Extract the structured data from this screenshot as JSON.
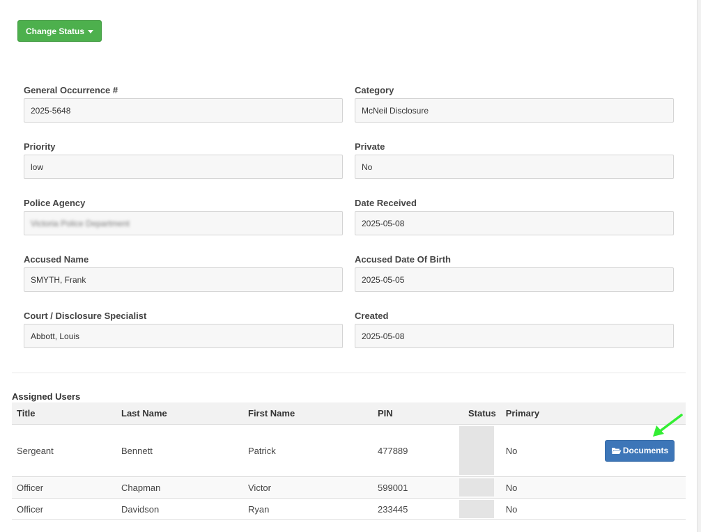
{
  "toolbar": {
    "change_status_label": "Change Status"
  },
  "form": {
    "general_occurrence": {
      "label": "General Occurrence #",
      "value": "2025-5648"
    },
    "category": {
      "label": "Category",
      "value": "McNeil Disclosure"
    },
    "priority": {
      "label": "Priority",
      "value": "low"
    },
    "private": {
      "label": "Private",
      "value": "No"
    },
    "police_agency": {
      "label": "Police Agency",
      "value": "Victoria Police Department"
    },
    "date_received": {
      "label": "Date Received",
      "value": "2025-05-08"
    },
    "accused_name": {
      "label": "Accused Name",
      "value": "SMYTH, Frank"
    },
    "accused_dob": {
      "label": "Accused Date Of Birth",
      "value": "2025-05-05"
    },
    "court_specialist": {
      "label": "Court / Disclosure Specialist",
      "value": "Abbott, Louis"
    },
    "created": {
      "label": "Created",
      "value": "2025-05-08"
    }
  },
  "assigned_users": {
    "title": "Assigned Users",
    "columns": [
      "Title",
      "Last Name",
      "First Name",
      "PIN",
      "Status",
      "Primary"
    ],
    "rows": [
      {
        "title": "Sergeant",
        "last": "Bennett",
        "first": "Patrick",
        "pin": "477889",
        "primary": "No"
      },
      {
        "title": "Officer",
        "last": "Chapman",
        "first": "Victor",
        "pin": "599001",
        "primary": "No"
      },
      {
        "title": "Officer",
        "last": "Davidson",
        "first": "Ryan",
        "pin": "233445",
        "primary": "No"
      }
    ],
    "documents_label": "Documents"
  },
  "colors": {
    "status_button": "#4db04d",
    "documents_button": "#3d76b8",
    "annotation_arrow": "#33ee33"
  },
  "icons": {
    "caret": "caret-down-icon",
    "folder": "folder-open-icon",
    "arrow": "annotation-arrow-icon"
  }
}
